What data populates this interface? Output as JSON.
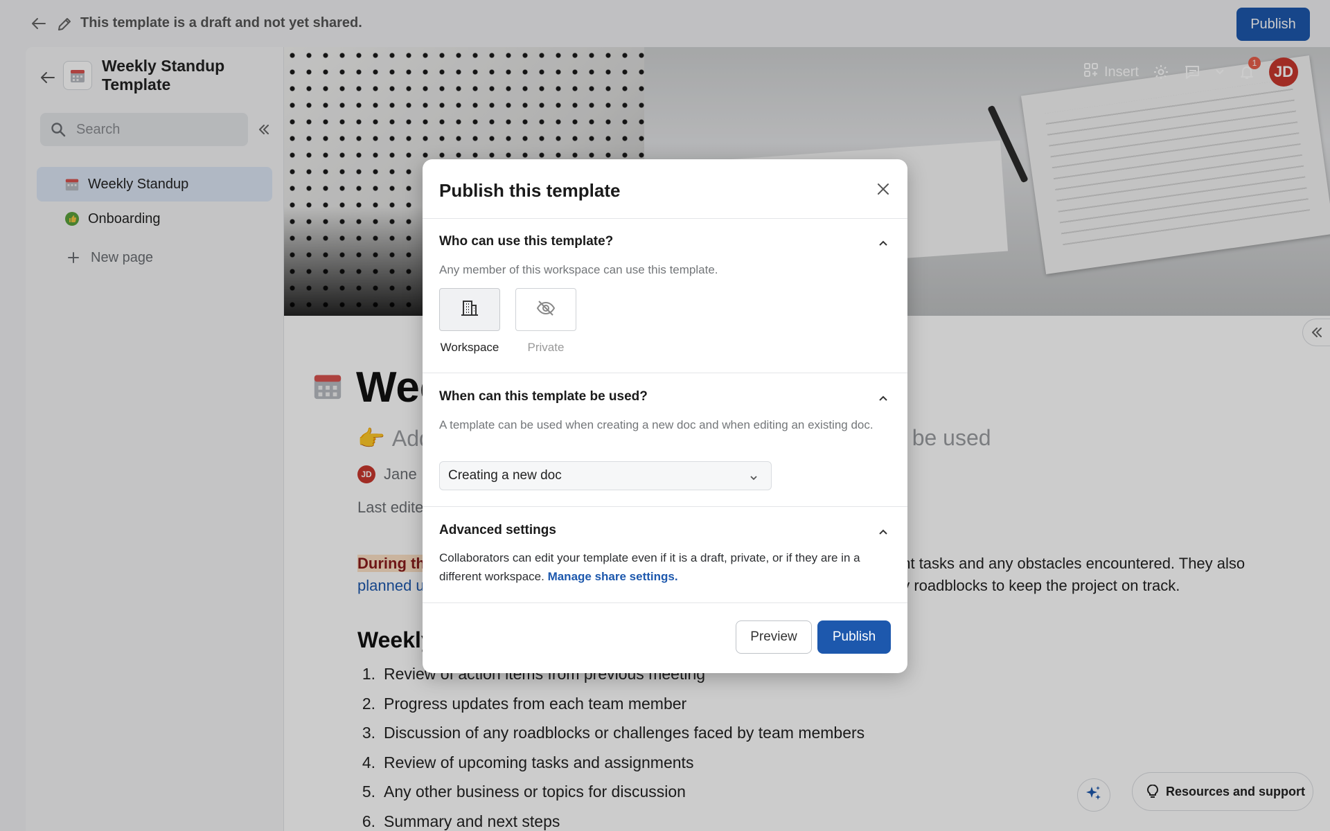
{
  "topbar": {
    "draft_notice": "This template is a draft and not yet shared.",
    "publish_label": "Publish"
  },
  "sidebar": {
    "doc_title": "Weekly Standup Template",
    "search_placeholder": "Search",
    "items": [
      {
        "label": "Weekly Standup",
        "icon": "calendar-icon",
        "active": true
      },
      {
        "label": "Onboarding",
        "icon": "thumbs-up-icon",
        "active": false
      }
    ],
    "new_page_label": "New page"
  },
  "toolbar": {
    "insert_label": "Insert",
    "notification_count": "1",
    "avatar_initials": "JD"
  },
  "document": {
    "title": "Wee",
    "subtitle_left": "Add",
    "subtitle_right": "d be used",
    "author": "Jane",
    "author_initials": "JD",
    "last_edited": "Last edite",
    "para_highlight": "During th",
    "para_link": "planned u",
    "para_right_line1": "ent tasks and any obstacles encountered. They also",
    "para_right_line2": "ny roadblocks to keep the project on track.",
    "agenda_title": "Weekly",
    "agenda": [
      {
        "num": "1.",
        "text": "Review of action items from previous meeting"
      },
      {
        "num": "2.",
        "text": "Progress updates from each team member"
      },
      {
        "num": "3.",
        "text": "Discussion of any roadblocks or challenges faced by team members"
      },
      {
        "num": "4.",
        "text": "Review of upcoming tasks and assignments"
      },
      {
        "num": "5.",
        "text": "Any other business or topics for discussion"
      },
      {
        "num": "6.",
        "text": "Summary and next steps"
      }
    ]
  },
  "resources_label": "Resources and support",
  "modal": {
    "title": "Publish this template",
    "who": {
      "heading": "Who can use this template?",
      "description": "Any member of this workspace can use this template.",
      "options": [
        {
          "label": "Workspace",
          "icon": "building-icon",
          "selected": true
        },
        {
          "label": "Private",
          "icon": "eye-off-icon",
          "selected": false
        }
      ]
    },
    "when": {
      "heading": "When can this template be used?",
      "description": "A template can be used when creating a new doc and when editing an existing doc.",
      "select_value": "Creating a new doc"
    },
    "advanced": {
      "heading": "Advanced settings",
      "description": "Collaborators can edit your template even if it is a draft, private, or if they are in a different workspace.",
      "link": "Manage share settings."
    },
    "preview_label": "Preview",
    "publish_label": "Publish"
  },
  "colors": {
    "accent": "#1d58ad",
    "avatar": "#c8372d",
    "badge": "#e8604c"
  }
}
